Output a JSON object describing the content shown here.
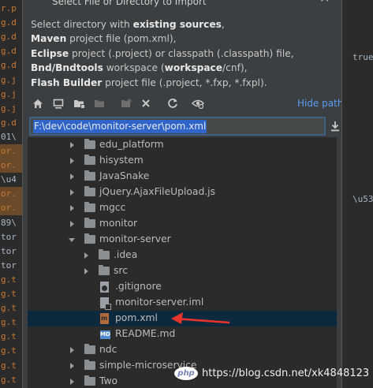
{
  "background_editor": {
    "left_fragments": [
      "r.p",
      "g.d",
      "g.d",
      "g.d",
      "g.d",
      "g.j",
      "g.j",
      "g.j",
      "g.d",
      "01\\",
      "or.",
      "or.",
      "\\u4",
      "or.",
      "or.",
      "89\\",
      "tor",
      "tor",
      "tor",
      "g.t",
      "g.t",
      "g.t",
      "g.t",
      "g.t",
      "g.t",
      "g.t",
      "g.t"
    ],
    "right_fragments": [
      "true",
      "\\u53"
    ]
  },
  "dialog": {
    "title": "Select File or Directory to Import",
    "description": {
      "line1_prefix": "Select directory with ",
      "line1_bold": "existing sources",
      "line1_suffix": ",",
      "line2_bold": "Maven",
      "line2_suffix": " project file (pom.xml),",
      "line3_bold": "Eclipse",
      "line3_suffix": " project (.project) or classpath (.classpath) file,",
      "line4_bold": "Bnd/Bndtools",
      "line4_mid": " workspace (",
      "line4_bold2": "workspace",
      "line4_suffix": "/cnf),",
      "line5_bold": "Flash Builder",
      "line5_suffix": " project file (.project, *.fxp, *.fxpl)."
    },
    "toolbar": {
      "icons": [
        "home-icon",
        "desktop-icon",
        "project-folder-icon",
        "module-folder-icon",
        "new-folder-icon",
        "delete-icon",
        "refresh-icon",
        "show-hidden-icon"
      ],
      "hide_path_label": "Hide path"
    },
    "path_value": "F:\\dev\\code\\monitor-server\\pom.xml",
    "tree": [
      {
        "label": "edu_platform",
        "type": "folder",
        "expanded": false,
        "depth": 0
      },
      {
        "label": "hisystem",
        "type": "folder",
        "expanded": false,
        "depth": 0
      },
      {
        "label": "JavaSnake",
        "type": "folder",
        "expanded": false,
        "depth": 0
      },
      {
        "label": "jQuery.AjaxFileUpload.js",
        "type": "folder",
        "expanded": false,
        "depth": 0
      },
      {
        "label": "mgcc",
        "type": "folder",
        "expanded": false,
        "depth": 0
      },
      {
        "label": "monitor",
        "type": "folder",
        "expanded": false,
        "depth": 0
      },
      {
        "label": "monitor-server",
        "type": "folder",
        "expanded": true,
        "depth": 0
      },
      {
        "label": ".idea",
        "type": "folder",
        "expanded": false,
        "depth": 1
      },
      {
        "label": "src",
        "type": "folder",
        "expanded": false,
        "depth": 1
      },
      {
        "label": ".gitignore",
        "type": "git",
        "depth": 1
      },
      {
        "label": "monitor-server.iml",
        "type": "iml",
        "depth": 1
      },
      {
        "label": "pom.xml",
        "type": "maven",
        "depth": 1,
        "selected": true
      },
      {
        "label": "README.md",
        "type": "md",
        "depth": 1
      },
      {
        "label": "ndc",
        "type": "folder",
        "expanded": false,
        "depth": 0
      },
      {
        "label": "simple-microservice",
        "type": "folder",
        "expanded": false,
        "depth": 0
      },
      {
        "label": "Two",
        "type": "folder",
        "expanded": false,
        "depth": 0
      }
    ]
  },
  "watermark": {
    "logo": "php",
    "text": "https://blog.csdn.net/xk4848123"
  },
  "colors": {
    "dialog_bg": "#3c3f41",
    "tree_bg": "#2b2b2b",
    "selection": "#0d293e",
    "link": "#589df6",
    "path_highlight": "#2f65ca",
    "annotation_arrow": "#e8342b"
  }
}
